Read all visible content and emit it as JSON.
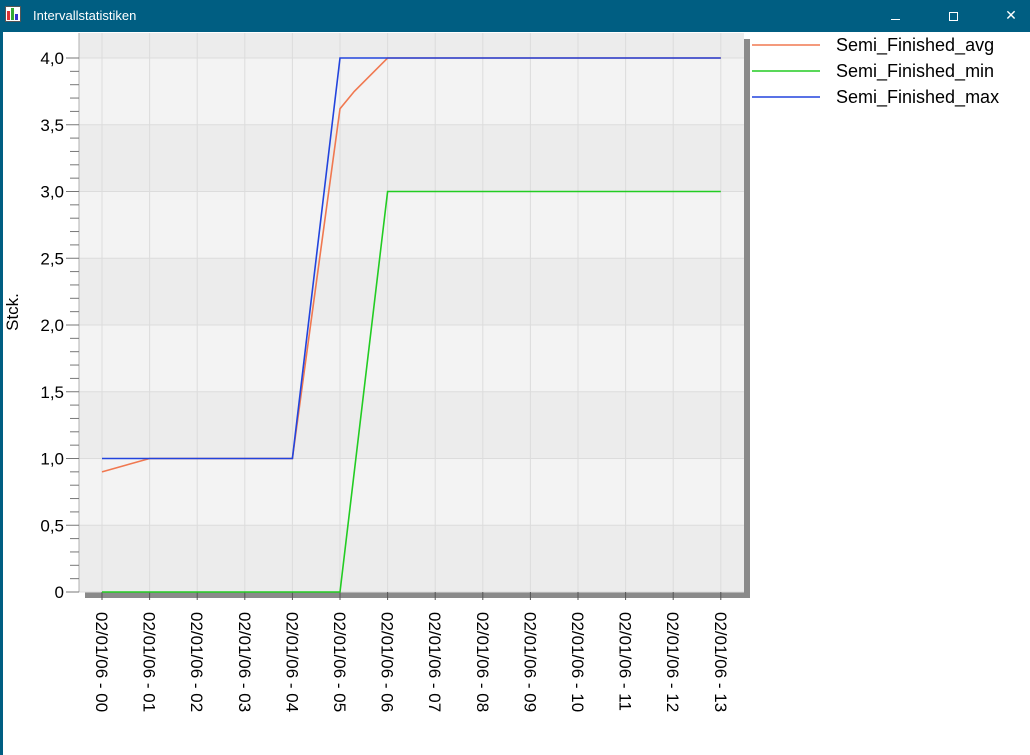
{
  "window": {
    "title": "Intervallstatistiken",
    "controls": {
      "minimize": "–",
      "maximize": "☐",
      "close": "✕"
    }
  },
  "colors": {
    "titlebar": "#005e82",
    "avg": "#f07850",
    "min": "#22cc22",
    "max": "#2244dd",
    "plot_band_light": "#f3f3f3",
    "plot_band_dark": "#ececec"
  },
  "chart_data": {
    "type": "line",
    "title": "",
    "xlabel": "",
    "ylabel": "Stck.",
    "ylim": [
      0,
      4
    ],
    "yticks": [
      0,
      0.5,
      1,
      1.5,
      2,
      2.5,
      3,
      3.5,
      4
    ],
    "ytick_labels": [
      "0",
      "0,5",
      "1,0",
      "1,5",
      "2,0",
      "2,5",
      "3,0",
      "3,5",
      "4,0"
    ],
    "categories": [
      "02/01/06 - 00",
      "02/01/06 - 01",
      "02/01/06 - 02",
      "02/01/06 - 03",
      "02/01/06 - 04",
      "02/01/06 - 05",
      "02/01/06 - 06",
      "02/01/06 - 07",
      "02/01/06 - 08",
      "02/01/06 - 09",
      "02/01/06 - 10",
      "02/01/06 - 11",
      "02/01/06 - 12",
      "02/01/06 - 13"
    ],
    "grid": true,
    "legend": "top-right",
    "series": [
      {
        "name": "Semi_Finished_avg",
        "x": [
          0,
          1,
          2,
          3,
          4,
          5,
          5.3,
          6,
          7,
          8,
          9,
          10,
          11,
          12,
          13
        ],
        "values": [
          0.9,
          1.0,
          1.0,
          1.0,
          1.0,
          3.62,
          3.75,
          4.0,
          4.0,
          4.0,
          4.0,
          4.0,
          4.0,
          4.0,
          4.0
        ],
        "color": "#f07850"
      },
      {
        "name": "Semi_Finished_min",
        "x": [
          0,
          1,
          2,
          3,
          4,
          5,
          6,
          7,
          8,
          9,
          10,
          11,
          12,
          13
        ],
        "values": [
          0,
          0,
          0,
          0,
          0,
          0,
          3,
          3,
          3,
          3,
          3,
          3,
          3,
          3
        ],
        "color": "#22cc22"
      },
      {
        "name": "Semi_Finished_max",
        "x": [
          0,
          1,
          2,
          3,
          4,
          5,
          6,
          7,
          8,
          9,
          10,
          11,
          12,
          13
        ],
        "values": [
          1,
          1,
          1,
          1,
          1,
          4,
          4,
          4,
          4,
          4,
          4,
          4,
          4,
          4
        ],
        "color": "#2244dd"
      }
    ]
  }
}
